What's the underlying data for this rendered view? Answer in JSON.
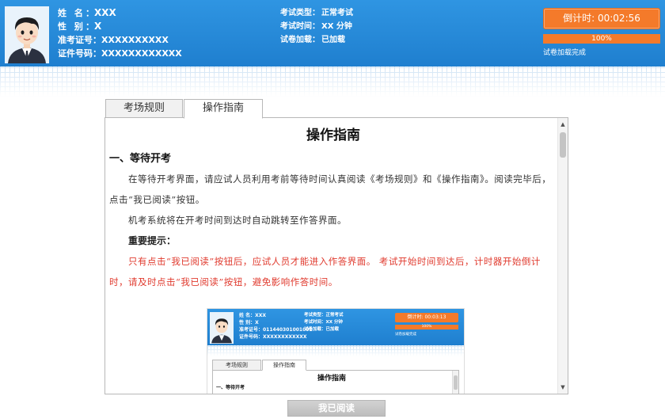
{
  "candidate": {
    "name_label": "姓 名：",
    "name_value": "XXX",
    "gender_label": "性 别：",
    "gender_value": "X",
    "admission_label": "准考证号：",
    "admission_value": "XXXXXXXXXX",
    "id_label": "证件号码：",
    "id_value": "XXXXXXXXXXXX"
  },
  "exam": {
    "type_label": "考试类型：",
    "type_value": "正常考试",
    "duration_label": "考试时间：",
    "duration_value": "XX 分钟",
    "paper_label": "试卷加载：",
    "paper_value": "已加载"
  },
  "countdown": {
    "label": "倒计时:",
    "time": "00:02:56"
  },
  "progress": {
    "fraction": 1.0,
    "text": "100%",
    "status": "试卷加载完成"
  },
  "tabs": [
    {
      "label": "考场规则",
      "active": false
    },
    {
      "label": "操作指南",
      "active": true
    }
  ],
  "guide": {
    "title": "操作指南",
    "section1_title": "一、等待开考",
    "p1": "在等待开考界面，请应试人员利用考前等待时间认真阅读《考场规则》和《操作指南》。阅读完毕后，点击“我已阅读”按钮。",
    "p2": "机考系统将在开考时间到达时自动跳转至作答界面。",
    "important_title": "重要提示：",
    "important_text": "只有点击“我已阅读”按钮后，应试人员才能进入作答界面。 考试开始时间到达后，计时器开始倒计时，请及时点击“我已阅读”按钮，避免影响作答时间。"
  },
  "thumbnail": {
    "name_row": "姓 名：XXX",
    "gender_row": "性 别：X",
    "admission_row": "准考证号：011440301001001",
    "id_row": "证件号码：XXXXXXXXXXXX",
    "type_row": "考试类型：正常考试",
    "duration_row": "考试时间：XX 分钟",
    "paper_row": "试卷加载：已加载",
    "countdown": "倒计时: 00:03:13",
    "progress_text": "100%",
    "status": "试卷加载完成",
    "tab1": "考场规则",
    "tab2": "操作指南",
    "title": "操作指南",
    "section1": "一、等待开考"
  },
  "button": {
    "read_label": "我已阅读"
  },
  "colors": {
    "header_blue": "#1f7fcf",
    "accent_orange": "#f47a2a",
    "warning_red": "#e03a2e"
  }
}
